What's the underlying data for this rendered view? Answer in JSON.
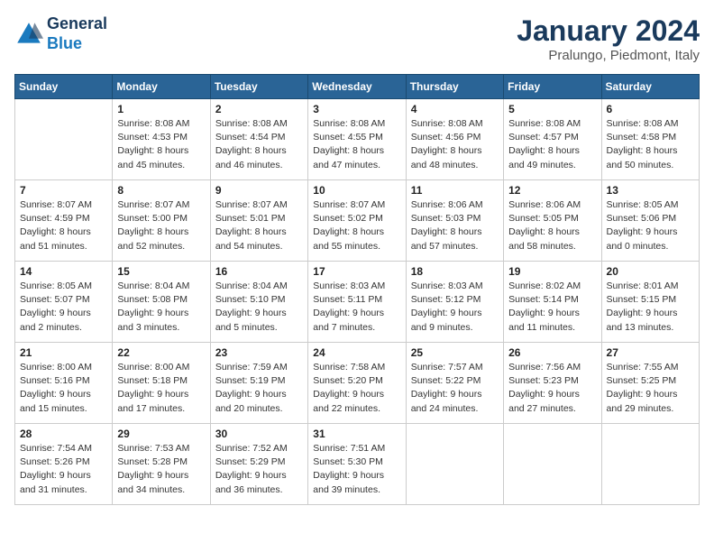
{
  "header": {
    "logo_line1": "General",
    "logo_line2": "Blue",
    "title": "January 2024",
    "subtitle": "Pralungo, Piedmont, Italy"
  },
  "calendar": {
    "days_of_week": [
      "Sunday",
      "Monday",
      "Tuesday",
      "Wednesday",
      "Thursday",
      "Friday",
      "Saturday"
    ],
    "weeks": [
      [
        {
          "day": "",
          "sunrise": "",
          "sunset": "",
          "daylight": ""
        },
        {
          "day": "1",
          "sunrise": "Sunrise: 8:08 AM",
          "sunset": "Sunset: 4:53 PM",
          "daylight": "Daylight: 8 hours and 45 minutes."
        },
        {
          "day": "2",
          "sunrise": "Sunrise: 8:08 AM",
          "sunset": "Sunset: 4:54 PM",
          "daylight": "Daylight: 8 hours and 46 minutes."
        },
        {
          "day": "3",
          "sunrise": "Sunrise: 8:08 AM",
          "sunset": "Sunset: 4:55 PM",
          "daylight": "Daylight: 8 hours and 47 minutes."
        },
        {
          "day": "4",
          "sunrise": "Sunrise: 8:08 AM",
          "sunset": "Sunset: 4:56 PM",
          "daylight": "Daylight: 8 hours and 48 minutes."
        },
        {
          "day": "5",
          "sunrise": "Sunrise: 8:08 AM",
          "sunset": "Sunset: 4:57 PM",
          "daylight": "Daylight: 8 hours and 49 minutes."
        },
        {
          "day": "6",
          "sunrise": "Sunrise: 8:08 AM",
          "sunset": "Sunset: 4:58 PM",
          "daylight": "Daylight: 8 hours and 50 minutes."
        }
      ],
      [
        {
          "day": "7",
          "sunrise": "Sunrise: 8:07 AM",
          "sunset": "Sunset: 4:59 PM",
          "daylight": "Daylight: 8 hours and 51 minutes."
        },
        {
          "day": "8",
          "sunrise": "Sunrise: 8:07 AM",
          "sunset": "Sunset: 5:00 PM",
          "daylight": "Daylight: 8 hours and 52 minutes."
        },
        {
          "day": "9",
          "sunrise": "Sunrise: 8:07 AM",
          "sunset": "Sunset: 5:01 PM",
          "daylight": "Daylight: 8 hours and 54 minutes."
        },
        {
          "day": "10",
          "sunrise": "Sunrise: 8:07 AM",
          "sunset": "Sunset: 5:02 PM",
          "daylight": "Daylight: 8 hours and 55 minutes."
        },
        {
          "day": "11",
          "sunrise": "Sunrise: 8:06 AM",
          "sunset": "Sunset: 5:03 PM",
          "daylight": "Daylight: 8 hours and 57 minutes."
        },
        {
          "day": "12",
          "sunrise": "Sunrise: 8:06 AM",
          "sunset": "Sunset: 5:05 PM",
          "daylight": "Daylight: 8 hours and 58 minutes."
        },
        {
          "day": "13",
          "sunrise": "Sunrise: 8:05 AM",
          "sunset": "Sunset: 5:06 PM",
          "daylight": "Daylight: 9 hours and 0 minutes."
        }
      ],
      [
        {
          "day": "14",
          "sunrise": "Sunrise: 8:05 AM",
          "sunset": "Sunset: 5:07 PM",
          "daylight": "Daylight: 9 hours and 2 minutes."
        },
        {
          "day": "15",
          "sunrise": "Sunrise: 8:04 AM",
          "sunset": "Sunset: 5:08 PM",
          "daylight": "Daylight: 9 hours and 3 minutes."
        },
        {
          "day": "16",
          "sunrise": "Sunrise: 8:04 AM",
          "sunset": "Sunset: 5:10 PM",
          "daylight": "Daylight: 9 hours and 5 minutes."
        },
        {
          "day": "17",
          "sunrise": "Sunrise: 8:03 AM",
          "sunset": "Sunset: 5:11 PM",
          "daylight": "Daylight: 9 hours and 7 minutes."
        },
        {
          "day": "18",
          "sunrise": "Sunrise: 8:03 AM",
          "sunset": "Sunset: 5:12 PM",
          "daylight": "Daylight: 9 hours and 9 minutes."
        },
        {
          "day": "19",
          "sunrise": "Sunrise: 8:02 AM",
          "sunset": "Sunset: 5:14 PM",
          "daylight": "Daylight: 9 hours and 11 minutes."
        },
        {
          "day": "20",
          "sunrise": "Sunrise: 8:01 AM",
          "sunset": "Sunset: 5:15 PM",
          "daylight": "Daylight: 9 hours and 13 minutes."
        }
      ],
      [
        {
          "day": "21",
          "sunrise": "Sunrise: 8:00 AM",
          "sunset": "Sunset: 5:16 PM",
          "daylight": "Daylight: 9 hours and 15 minutes."
        },
        {
          "day": "22",
          "sunrise": "Sunrise: 8:00 AM",
          "sunset": "Sunset: 5:18 PM",
          "daylight": "Daylight: 9 hours and 17 minutes."
        },
        {
          "day": "23",
          "sunrise": "Sunrise: 7:59 AM",
          "sunset": "Sunset: 5:19 PM",
          "daylight": "Daylight: 9 hours and 20 minutes."
        },
        {
          "day": "24",
          "sunrise": "Sunrise: 7:58 AM",
          "sunset": "Sunset: 5:20 PM",
          "daylight": "Daylight: 9 hours and 22 minutes."
        },
        {
          "day": "25",
          "sunrise": "Sunrise: 7:57 AM",
          "sunset": "Sunset: 5:22 PM",
          "daylight": "Daylight: 9 hours and 24 minutes."
        },
        {
          "day": "26",
          "sunrise": "Sunrise: 7:56 AM",
          "sunset": "Sunset: 5:23 PM",
          "daylight": "Daylight: 9 hours and 27 minutes."
        },
        {
          "day": "27",
          "sunrise": "Sunrise: 7:55 AM",
          "sunset": "Sunset: 5:25 PM",
          "daylight": "Daylight: 9 hours and 29 minutes."
        }
      ],
      [
        {
          "day": "28",
          "sunrise": "Sunrise: 7:54 AM",
          "sunset": "Sunset: 5:26 PM",
          "daylight": "Daylight: 9 hours and 31 minutes."
        },
        {
          "day": "29",
          "sunrise": "Sunrise: 7:53 AM",
          "sunset": "Sunset: 5:28 PM",
          "daylight": "Daylight: 9 hours and 34 minutes."
        },
        {
          "day": "30",
          "sunrise": "Sunrise: 7:52 AM",
          "sunset": "Sunset: 5:29 PM",
          "daylight": "Daylight: 9 hours and 36 minutes."
        },
        {
          "day": "31",
          "sunrise": "Sunrise: 7:51 AM",
          "sunset": "Sunset: 5:30 PM",
          "daylight": "Daylight: 9 hours and 39 minutes."
        },
        {
          "day": "",
          "sunrise": "",
          "sunset": "",
          "daylight": ""
        },
        {
          "day": "",
          "sunrise": "",
          "sunset": "",
          "daylight": ""
        },
        {
          "day": "",
          "sunrise": "",
          "sunset": "",
          "daylight": ""
        }
      ]
    ]
  }
}
